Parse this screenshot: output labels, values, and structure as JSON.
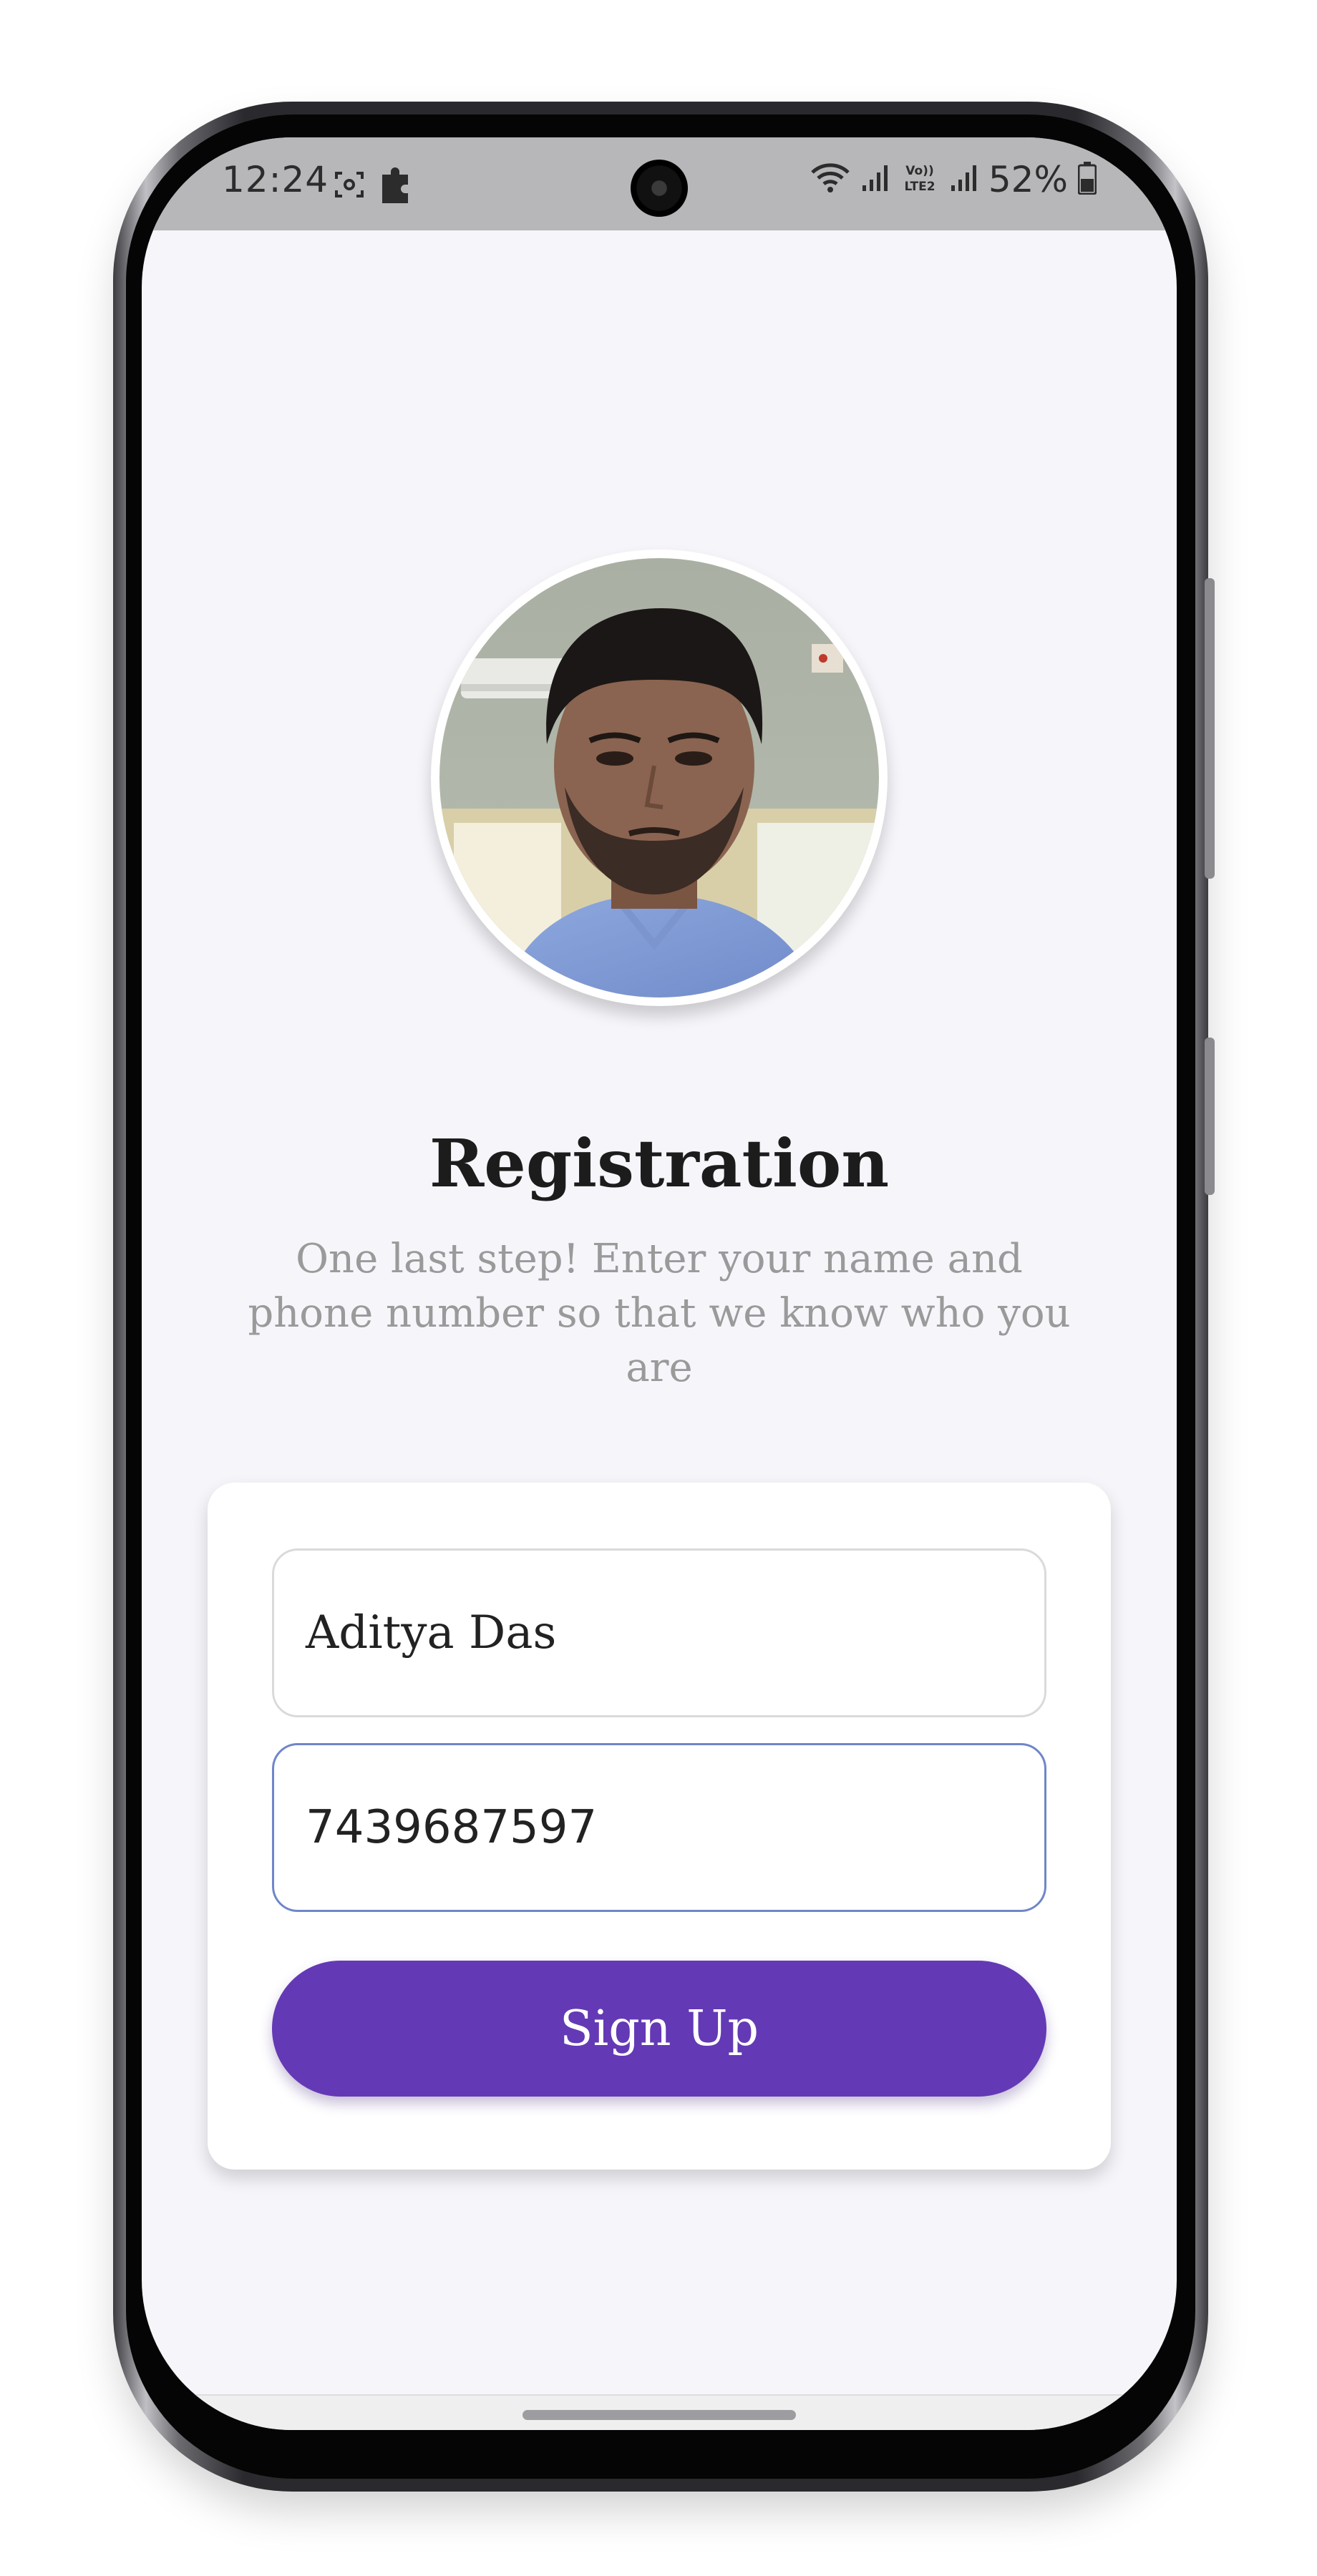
{
  "status_bar": {
    "time": "12:24",
    "battery": "52%",
    "icons": [
      "screenshot-icon",
      "puzzle-icon",
      "wifi-icon",
      "signal-icon",
      "volte-lte2-icon",
      "signal-icon",
      "battery-icon"
    ]
  },
  "registration": {
    "title": "Registration",
    "subtitle": "One last step! Enter your name and phone number so that we know who you are",
    "name_value": "Aditya Das",
    "phone_value": "7439687597",
    "signup_label": "Sign Up"
  },
  "colors": {
    "accent": "#6439b5",
    "background": "#f6f5fa",
    "focused_border": "#6f86c8"
  }
}
